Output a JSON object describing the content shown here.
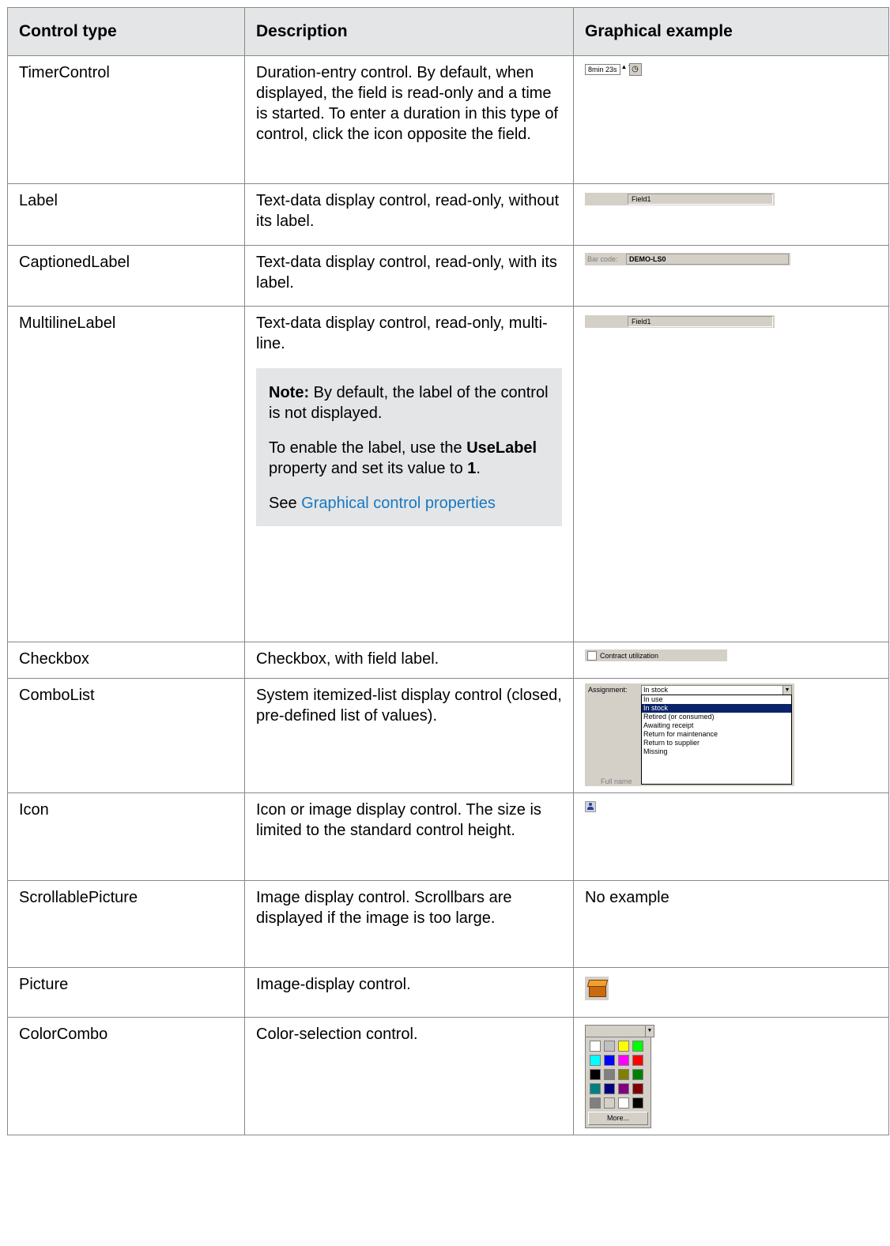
{
  "headers": [
    "Control type",
    "Description",
    "Graphical example"
  ],
  "rows": [
    {
      "type": "TimerControl",
      "desc": "Duration-entry control. By default, when displayed, the field is read-only and a time is started. To enter a duration in this type of control, click the icon opposite the field."
    },
    {
      "type": "Label",
      "desc": "Text-data display control, read-only, without its label."
    },
    {
      "type": "CaptionedLabel",
      "desc": "Text-data display control, read-only, with its label."
    },
    {
      "type": "MultilineLabel",
      "desc": "Text-data display control, read-only, multi-line."
    },
    {
      "type": "Checkbox",
      "desc": "Checkbox, with field label."
    },
    {
      "type": "ComboList",
      "desc": "System itemized-list display control (closed, pre-defined list of values)."
    },
    {
      "type": "Icon",
      "desc": "Icon or image display control. The size is limited to the standard control height."
    },
    {
      "type": "ScrollablePicture",
      "desc": "Image display control. Scrollbars are displayed if the image is too large."
    },
    {
      "type": "Picture",
      "desc": "Image-display control."
    },
    {
      "type": "ColorCombo",
      "desc": "Color-selection control."
    }
  ],
  "note": {
    "lead": "Note:",
    "line1": " By default, the label of the control is not displayed.",
    "line2_a": "To enable the label, use the ",
    "line2_b": "UseLabel",
    "line2_c": " property and set its value to ",
    "line2_d": "1",
    "line2_e": ".",
    "see": "See ",
    "link": "Graphical control properties"
  },
  "examples": {
    "timer": {
      "value": "8min 23s",
      "spin": "▲▼",
      "clock": "◷"
    },
    "label_field": "Field1",
    "captioned": {
      "caption": "Bar code:",
      "value": "DEMO-LS0"
    },
    "multiline_field": "Field1",
    "checkbox": "Contract utilization",
    "combo": {
      "caption": "Assignment:",
      "selected": "In stock",
      "options": [
        "In use",
        "In stock",
        "Retired (or consumed)",
        "Awaiting receipt",
        "Return for maintenance",
        "Return to supplier",
        "Missing"
      ],
      "highlighted_index": 1,
      "behind": "Full name"
    },
    "scrollable": "No example",
    "color": {
      "swatches": [
        "#ffffff",
        "#c0c0c0",
        "#ffff00",
        "#00ff00",
        "#00ffff",
        "#0000ff",
        "#ff00ff",
        "#ff0000",
        "#000000",
        "#808080",
        "#808000",
        "#008000",
        "#008080",
        "#000080",
        "#800080",
        "#800000",
        "#808080",
        "#d4d0c8",
        "#ffffff",
        "#000000"
      ],
      "more": "More..."
    }
  }
}
